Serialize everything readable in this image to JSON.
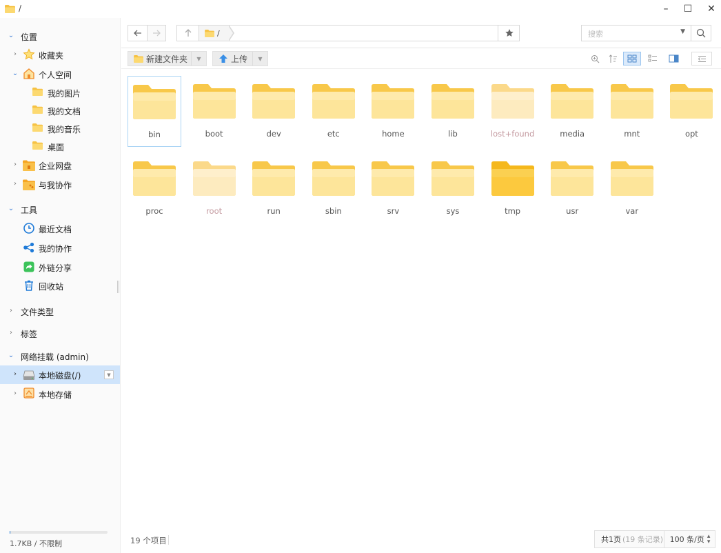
{
  "window": {
    "title": "/",
    "minimize": "–",
    "maximize": "☐",
    "close": "✕"
  },
  "sidebar": {
    "location": {
      "label": "位置"
    },
    "items": [
      {
        "label": "收藏夹"
      },
      {
        "label": "个人空间"
      },
      {
        "label": "我的图片"
      },
      {
        "label": "我的文档"
      },
      {
        "label": "我的音乐"
      },
      {
        "label": "桌面"
      },
      {
        "label": "企业网盘"
      },
      {
        "label": "与我协作"
      }
    ],
    "tools": {
      "label": "工具"
    },
    "tool_items": [
      {
        "label": "最近文档"
      },
      {
        "label": "我的协作"
      },
      {
        "label": "外链分享"
      },
      {
        "label": "回收站"
      }
    ],
    "file_types": {
      "label": "文件类型"
    },
    "tags": {
      "label": "标签"
    },
    "mounts": {
      "label": "网络挂载 (admin)"
    },
    "mount_items": [
      {
        "label": "本地磁盘(/)"
      },
      {
        "label": "本地存储"
      }
    ],
    "storage": {
      "text": "1.7KB / 不限制",
      "used_fraction": 0.01
    }
  },
  "nav": {
    "path": "/",
    "search_placeholder": "搜索"
  },
  "toolbar": {
    "new_folder": "新建文件夹",
    "upload": "上传"
  },
  "files": [
    {
      "name": "bin"
    },
    {
      "name": "boot"
    },
    {
      "name": "dev"
    },
    {
      "name": "etc"
    },
    {
      "name": "home"
    },
    {
      "name": "lib"
    },
    {
      "name": "lost+found"
    },
    {
      "name": "media"
    },
    {
      "name": "mnt"
    },
    {
      "name": "opt"
    },
    {
      "name": "proc"
    },
    {
      "name": "root"
    },
    {
      "name": "run"
    },
    {
      "name": "sbin"
    },
    {
      "name": "srv"
    },
    {
      "name": "sys"
    },
    {
      "name": "tmp"
    },
    {
      "name": "usr"
    },
    {
      "name": "var"
    }
  ],
  "status": {
    "item_count": "19 个项目",
    "pages": "共1页",
    "records": "(19 条记录)",
    "page_size": "100 条/页"
  },
  "colors": {
    "folder_back": "#f8c84a",
    "folder_front": "#fde59a",
    "selection": "#cfe4fb",
    "accent": "#1e7ad8"
  }
}
